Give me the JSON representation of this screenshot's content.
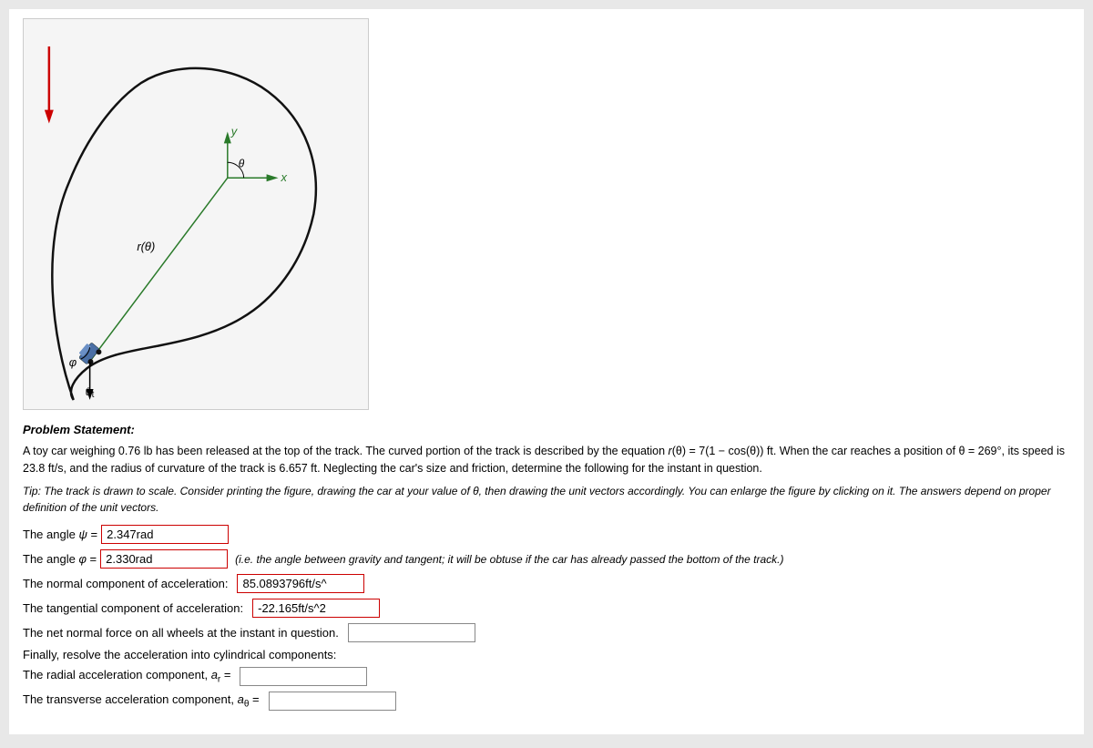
{
  "figure": {
    "alt": "Toy car on curved track diagram"
  },
  "problem": {
    "title": "Problem Statement:",
    "text": "A toy car weighing 0.76 lb has been released at the top of the track. The curved portion of the track is described by the equation r(θ) = 7(1 − cos(θ)) ft. When the car reaches a position of θ = 269°, its speed is 23.8 ft/s, and the radius of curvature of the track is 6.657 ft. Neglecting the car's size and friction, determine the following for the instant in question.",
    "tip": "Tip: The track is drawn to scale. Consider printing the figure, drawing the car at your value of θ, then drawing the unit vectors accordingly. You can enlarge the figure by clicking on it. The answers depend on proper definition of the unit vectors."
  },
  "fields": {
    "angle_psi_label": "The angle ψ =",
    "angle_psi_value": "2.347rad",
    "angle_phi_label": "The angle φ =",
    "angle_phi_value": "2.330rad",
    "angle_phi_hint": "(i.e. the angle between gravity and tangent; it will be obtuse if the car has already passed the bottom of the track.)",
    "normal_accel_label": "The normal component of acceleration:",
    "normal_accel_value": "85.0893796ft/s^",
    "tangential_accel_label": "The tangential component of acceleration:",
    "tangential_accel_value": "-22.165ft/s^2",
    "net_normal_force_label": "The net normal force on all wheels at the instant in question.",
    "net_normal_force_value": "",
    "cylindrical_label": "Finally, resolve the acceleration into cylindrical components:",
    "radial_accel_label": "The radial acceleration component, a_r =",
    "radial_accel_value": "",
    "transverse_accel_label": "The transverse acceleration component, a_θ =",
    "transverse_accel_value": ""
  }
}
